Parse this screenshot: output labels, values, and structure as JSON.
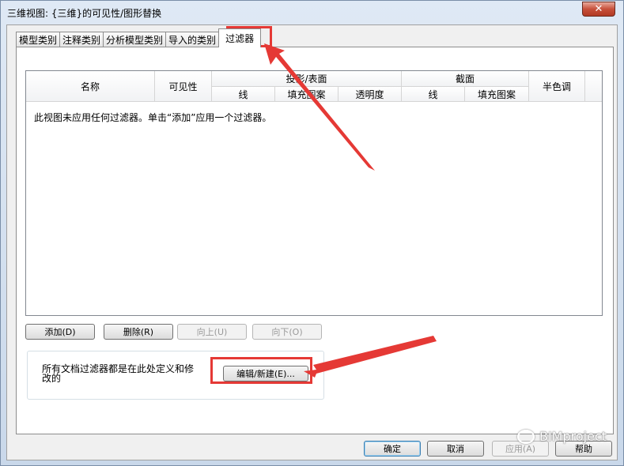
{
  "window": {
    "title": "三维视图: {三维}的可见性/图形替换",
    "close_glyph": "✕"
  },
  "tabs": [
    {
      "label": "模型类别",
      "active": false
    },
    {
      "label": "注释类别",
      "active": false
    },
    {
      "label": "分析模型类别",
      "active": false
    },
    {
      "label": "导入的类别",
      "active": false
    },
    {
      "label": "过滤器",
      "active": true
    }
  ],
  "grid": {
    "headers": {
      "name": "名称",
      "visibility": "可见性",
      "projection_surface": "投影/表面",
      "proj_line": "线",
      "proj_fill": "填充图案",
      "proj_transparency": "透明度",
      "cut": "截面",
      "cut_line": "线",
      "cut_fill": "填充图案",
      "halftone": "半色调"
    },
    "empty_message": "此视图未应用任何过滤器。单击“添加”应用一个过滤器。"
  },
  "row_buttons": {
    "add": "添加(D)",
    "remove": "删除(R)",
    "up": "向上(U)",
    "down": "向下(O)"
  },
  "filters_group": {
    "text": "所有文档过滤器都是在此处定义和修改的",
    "edit_new": "编辑/新建(E)..."
  },
  "dialog_buttons": {
    "ok": "确定",
    "cancel": "取消",
    "apply": "应用(A)",
    "help": "帮助"
  },
  "watermark": {
    "text": "BIMproject"
  },
  "colors": {
    "annotation_red": "#e53935",
    "dialog_bg": "#f0f0f0",
    "title_bg": "#dfe9f5"
  }
}
